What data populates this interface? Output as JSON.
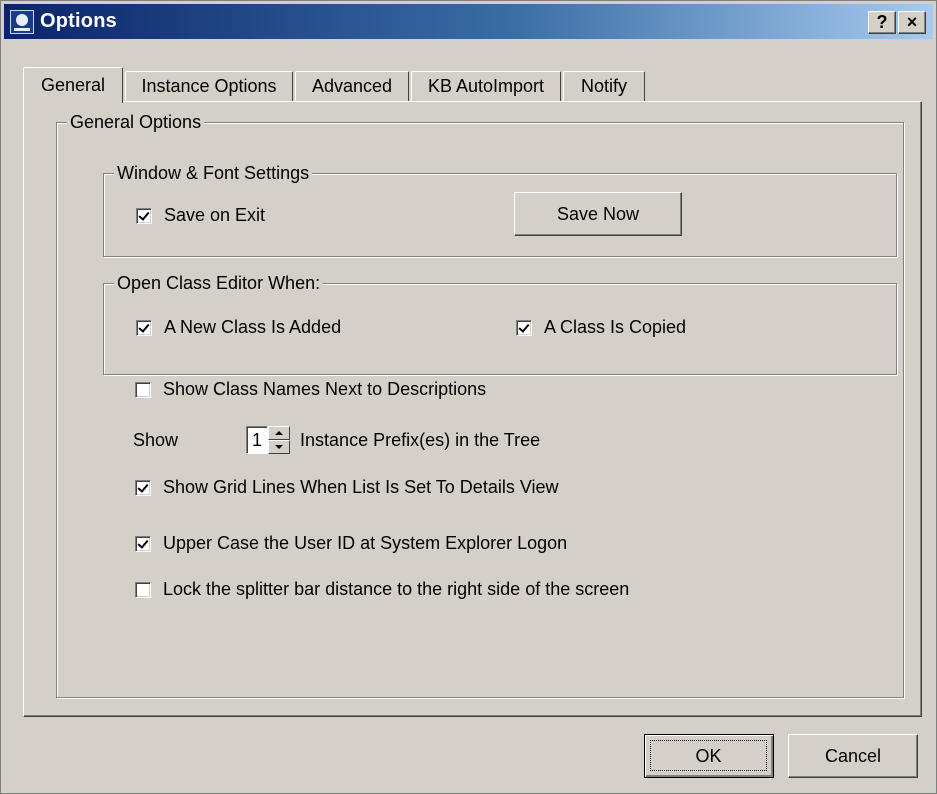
{
  "window": {
    "title": "Options",
    "help_label": "?",
    "close_label": "×"
  },
  "tabs": [
    {
      "label": "General",
      "active": true
    },
    {
      "label": "Instance Options",
      "active": false
    },
    {
      "label": "Advanced",
      "active": false
    },
    {
      "label": "KB AutoImport",
      "active": false
    },
    {
      "label": "Notify",
      "active": false
    }
  ],
  "general_options": {
    "legend": "General Options",
    "window_font": {
      "legend": "Window & Font Settings",
      "save_on_exit": {
        "label": "Save on Exit",
        "checked": true
      },
      "save_now_label": "Save Now"
    },
    "open_class_editor": {
      "legend": "Open Class Editor When:",
      "new_class_added": {
        "label": "A New Class Is Added",
        "checked": true
      },
      "class_copied": {
        "label": "A Class Is Copied",
        "checked": true
      }
    },
    "show_class_names": {
      "label": "Show Class Names Next to Descriptions",
      "checked": false
    },
    "instance_prefix": {
      "show_label": "Show",
      "value": "1",
      "suffix_label": "Instance Prefix(es) in the Tree"
    },
    "show_grid_lines": {
      "label": "Show Grid Lines When List Is Set To Details View",
      "checked": true
    },
    "upper_case_userid": {
      "label": "Upper Case the User ID at System Explorer Logon",
      "checked": true
    },
    "lock_splitter": {
      "label": "Lock the splitter bar distance to the right side of the screen",
      "checked": false
    }
  },
  "footer": {
    "ok_label": "OK",
    "cancel_label": "Cancel"
  }
}
